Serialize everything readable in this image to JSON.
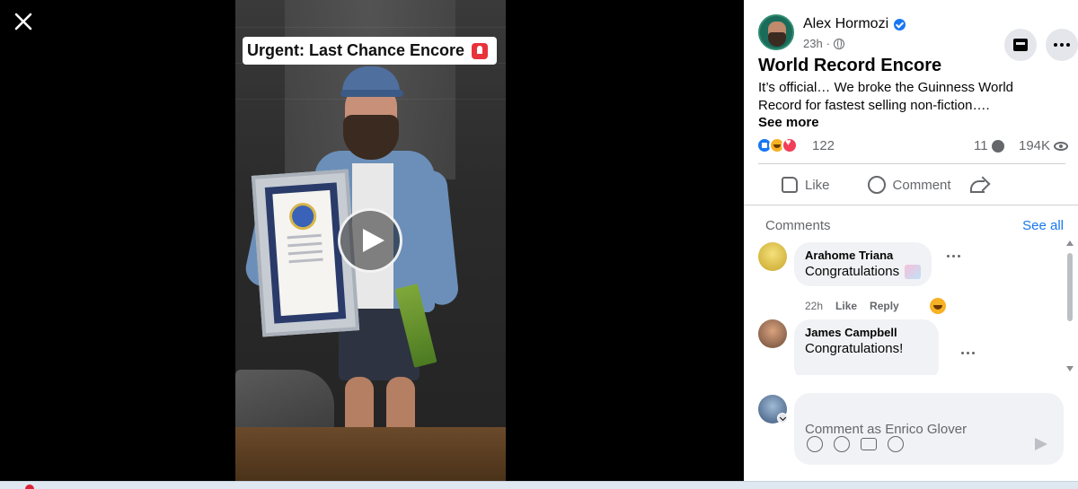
{
  "viewer": {
    "close_icon": "close-icon",
    "banner_text": "Urgent: Last Chance Encore",
    "banner_icon": "siren-icon",
    "play_icon": "play-icon"
  },
  "post": {
    "author": "Alex Hormozi",
    "time": "23h",
    "title": "World Record Encore",
    "description": "It’s official… We broke the Guinness World Record for fastest selling non-fiction….",
    "see_more": "See more",
    "reaction_count": "122",
    "comment_count": "11",
    "view_count": "194K"
  },
  "actions": {
    "like": "Like",
    "comment": "Comment"
  },
  "comments_section": {
    "header": "Comments",
    "see_all": "See all",
    "items": [
      {
        "name": "Arahome Triana",
        "text": "Congratulations",
        "time": "22h",
        "like": "Like",
        "reply": "Reply"
      },
      {
        "name": "James Campbell",
        "text": "Congratulations!"
      }
    ]
  },
  "composer": {
    "placeholder": "Comment as Enrico Glover"
  },
  "colors": {
    "accent": "#1877f2",
    "text_primary": "#050505",
    "text_secondary": "#65676b",
    "bubble_bg": "#f0f2f5"
  }
}
